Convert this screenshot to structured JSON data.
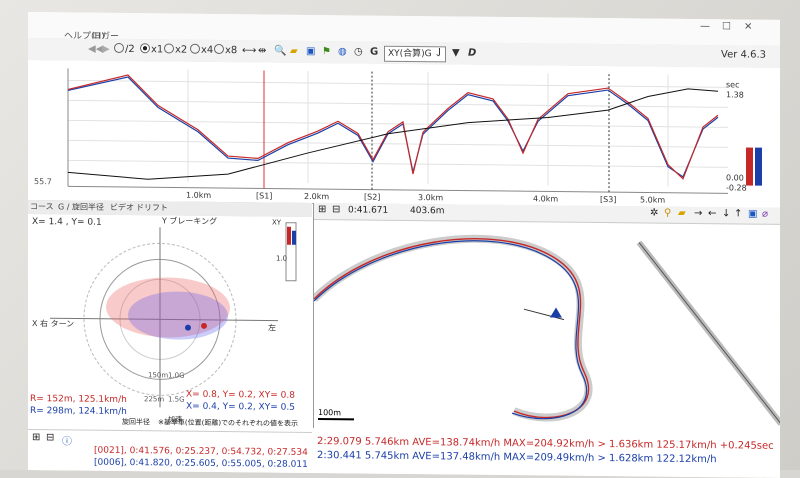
{
  "menu": {
    "item1": "ヘルプ(H)",
    "item2": "ロガー"
  },
  "toolbar": {
    "speed_options": [
      "/2",
      "x1",
      "x2",
      "x4",
      "x8"
    ],
    "selected_speed": "x1",
    "mode_select": "XY(合算)G",
    "version": "Ver 4.6.3"
  },
  "top_chart": {
    "y_left": "55.7",
    "sec_label": "sec",
    "sec_max": "1.38",
    "sec_mid": "0.00",
    "sec_min": "-0.28",
    "distance_ticks": [
      "1.0km",
      "2.0km",
      "3.0km",
      "4.0km",
      "5.0km"
    ],
    "sector_labels": [
      "[S1]",
      "[S2]",
      "[S3]"
    ]
  },
  "tabs": [
    "コース",
    "G / 旋回半径",
    "ビデオ",
    "ドリフト"
  ],
  "gpanel": {
    "xy_readout": "X=  1.4 , Y= 0.1",
    "y_axis_label": "Y ブレーキング",
    "x_axis_label_left": "X 右 ターン",
    "x_axis_label_right": "左",
    "xy_box_label": "XY",
    "scale_1g": "1.0",
    "ring_labels": [
      "150m",
      "1.0G",
      "225m",
      "1.5G"
    ],
    "accel_label": "加速",
    "legend_red": "X=  0.8, Y=  0.2, XY= 0.8",
    "legend_blue": "X=  0.4, Y=  0.2, XY= 0.5",
    "radius_label": "旋回半径",
    "note": "※基準車(位置(距離)でのそれぞれの値を表示",
    "r_red": "R= 152m, 125.1km/h",
    "r_blue": "R= 298m, 124.1km/h"
  },
  "bottom_left": {
    "row_red": "[0021], 0:41.576, 0:25.237, 0:54.732, 0:27.534",
    "row_blue": "[0006], 0:41.820, 0:25.605, 0:55.005, 0:28.011"
  },
  "map": {
    "time": "0:41.671",
    "distance": "403.6m",
    "scale": "100m"
  },
  "info": {
    "lap_red": "2:29.079 5.746km AVE=138.74km/h MAX=204.92km/h > 1.636km 125.17km/h +0.245sec",
    "lap_blue": "2:30.441 5.745km AVE=137.48km/h MAX=209.49km/h > 1.628km 122.12km/h"
  },
  "colors": {
    "red": "#c62828",
    "blue": "#1a3fa8",
    "black": "#111111"
  }
}
